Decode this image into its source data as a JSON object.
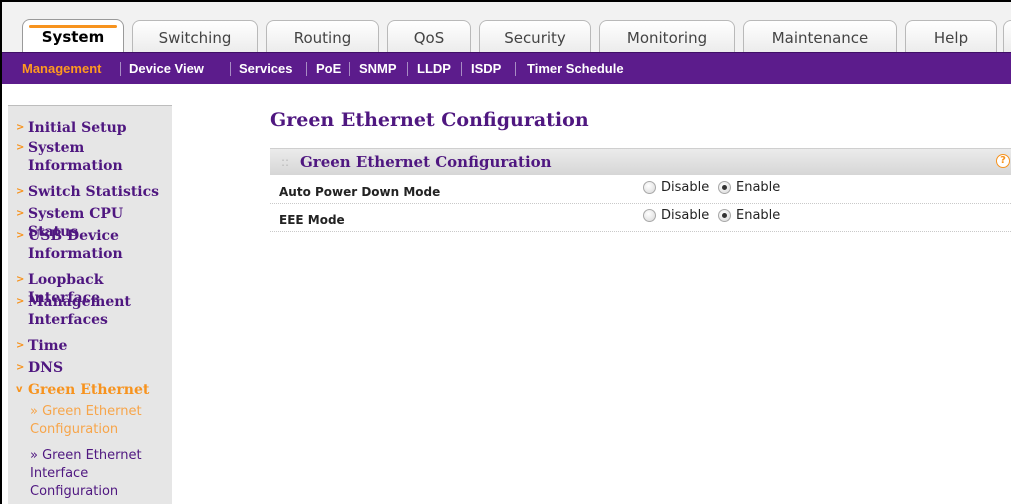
{
  "tabs": [
    {
      "label": "System",
      "active": true
    },
    {
      "label": "Switching",
      "active": false
    },
    {
      "label": "Routing",
      "active": false
    },
    {
      "label": "QoS",
      "active": false
    },
    {
      "label": "Security",
      "active": false
    },
    {
      "label": "Monitoring",
      "active": false
    },
    {
      "label": "Maintenance",
      "active": false
    },
    {
      "label": "Help",
      "active": false
    }
  ],
  "subnav": [
    {
      "label": "Management",
      "active": true
    },
    {
      "label": "Device View",
      "active": false
    },
    {
      "label": "Services",
      "active": false
    },
    {
      "label": "PoE",
      "active": false
    },
    {
      "label": "SNMP",
      "active": false
    },
    {
      "label": "LLDP",
      "active": false
    },
    {
      "label": "ISDP",
      "active": false
    },
    {
      "label": "Timer Schedule",
      "active": false
    }
  ],
  "sidebar": {
    "items": [
      {
        "label": "Initial Setup"
      },
      {
        "label": "System Information"
      },
      {
        "label": "Switch Statistics"
      },
      {
        "label": "System CPU Status"
      },
      {
        "label": "USB Device Information"
      },
      {
        "label": "Loopback Interface"
      },
      {
        "label": "Management Interfaces"
      },
      {
        "label": "Time"
      },
      {
        "label": "DNS"
      },
      {
        "label": "Green Ethernet",
        "expanded": true
      }
    ],
    "subitems": [
      {
        "label": "» Green Ethernet Configuration",
        "active": true
      },
      {
        "label": "» Green Ethernet Interface Configuration",
        "active": false
      }
    ]
  },
  "main": {
    "page_title": "Green Ethernet Configuration",
    "panel_title": "Green Ethernet Configuration",
    "help_glyph": "?",
    "rows": [
      {
        "label": "Auto Power Down Mode",
        "options": [
          "Disable",
          "Enable"
        ],
        "selected": "Enable"
      },
      {
        "label": "EEE Mode",
        "options": [
          "Disable",
          "Enable"
        ],
        "selected": "Enable"
      }
    ]
  },
  "colors": {
    "accent_purple": "#5c1c8c",
    "accent_orange": "#f7931e",
    "link_purple": "#4f1780"
  }
}
